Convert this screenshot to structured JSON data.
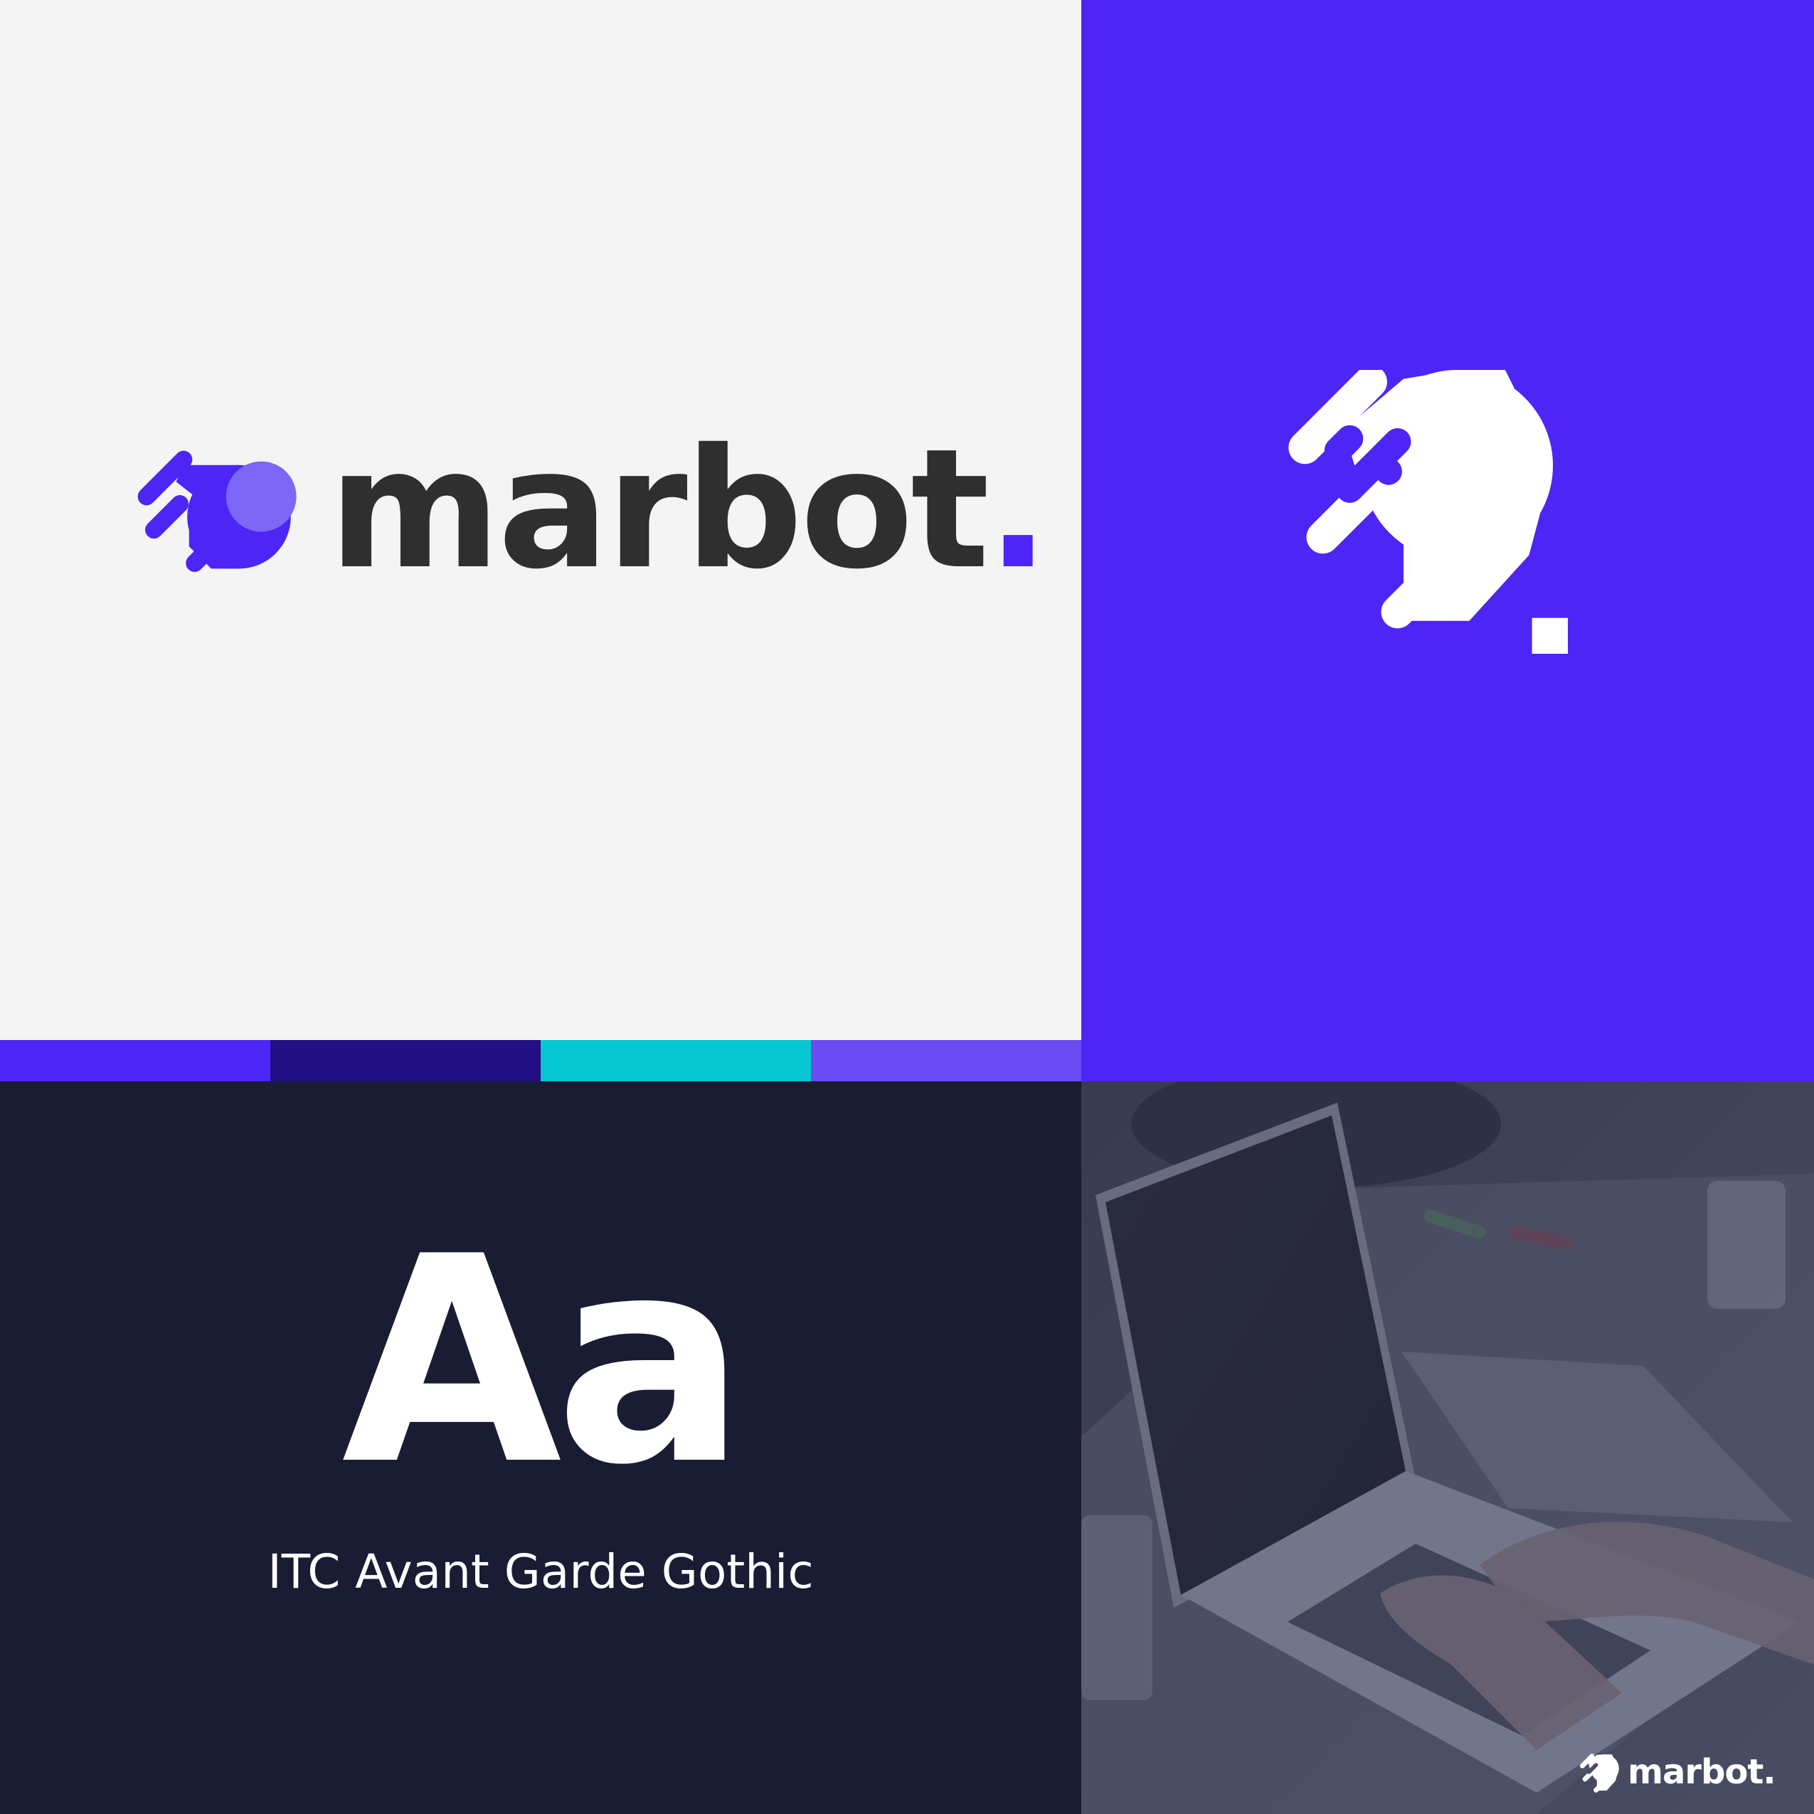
{
  "brand": {
    "name": "marbot",
    "dot": "."
  },
  "colors": {
    "primary": "#4d25f5",
    "deep": "#230f85",
    "cyan": "#05c8d2",
    "violet": "#6a4af2",
    "ink": "#2f2f2f",
    "navy": "#1a1c33",
    "light": "#f4f4f4"
  },
  "palette": [
    "#4d25f5",
    "#230f85",
    "#05c8d2",
    "#6a4af2"
  ],
  "typography": {
    "sample": "Aa",
    "font_name": "ITC Avant Garde Gothic"
  },
  "photo": {
    "subject": "hands typing on laptop at desk"
  },
  "icons": [
    "marbot-logo-mark-icon",
    "marbot-logo-mark-white-icon"
  ]
}
